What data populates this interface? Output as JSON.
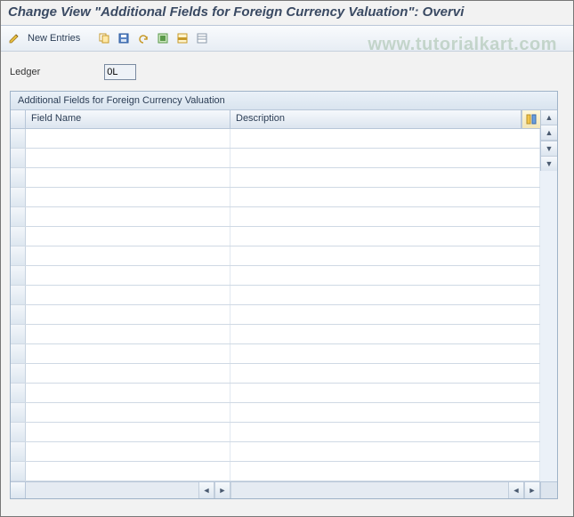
{
  "title": "Change View \"Additional Fields for Foreign Currency Valuation\": Overvi",
  "watermark": "www.tutorialkart.com",
  "toolbar": {
    "new_entries_label": "New Entries",
    "icons": {
      "toggle": "toggle-icon",
      "copy": "copy-icon",
      "save": "save-icon",
      "undo": "undo-icon",
      "select_all": "select-all-icon",
      "deselect_all": "deselect-all-icon",
      "table_settings": "table-settings-icon"
    }
  },
  "ledger": {
    "label": "Ledger",
    "value": "0L"
  },
  "panel": {
    "title": "Additional Fields for Foreign Currency Valuation",
    "columns": {
      "field_name": "Field Name",
      "description": "Description"
    },
    "config_icon": "configure-columns-icon",
    "rows": [
      {
        "field_name": "",
        "description": ""
      },
      {
        "field_name": "",
        "description": ""
      },
      {
        "field_name": "",
        "description": ""
      },
      {
        "field_name": "",
        "description": ""
      },
      {
        "field_name": "",
        "description": ""
      },
      {
        "field_name": "",
        "description": ""
      },
      {
        "field_name": "",
        "description": ""
      },
      {
        "field_name": "",
        "description": ""
      },
      {
        "field_name": "",
        "description": ""
      },
      {
        "field_name": "",
        "description": ""
      },
      {
        "field_name": "",
        "description": ""
      },
      {
        "field_name": "",
        "description": ""
      },
      {
        "field_name": "",
        "description": ""
      },
      {
        "field_name": "",
        "description": ""
      },
      {
        "field_name": "",
        "description": ""
      },
      {
        "field_name": "",
        "description": ""
      },
      {
        "field_name": "",
        "description": ""
      },
      {
        "field_name": "",
        "description": ""
      }
    ]
  }
}
